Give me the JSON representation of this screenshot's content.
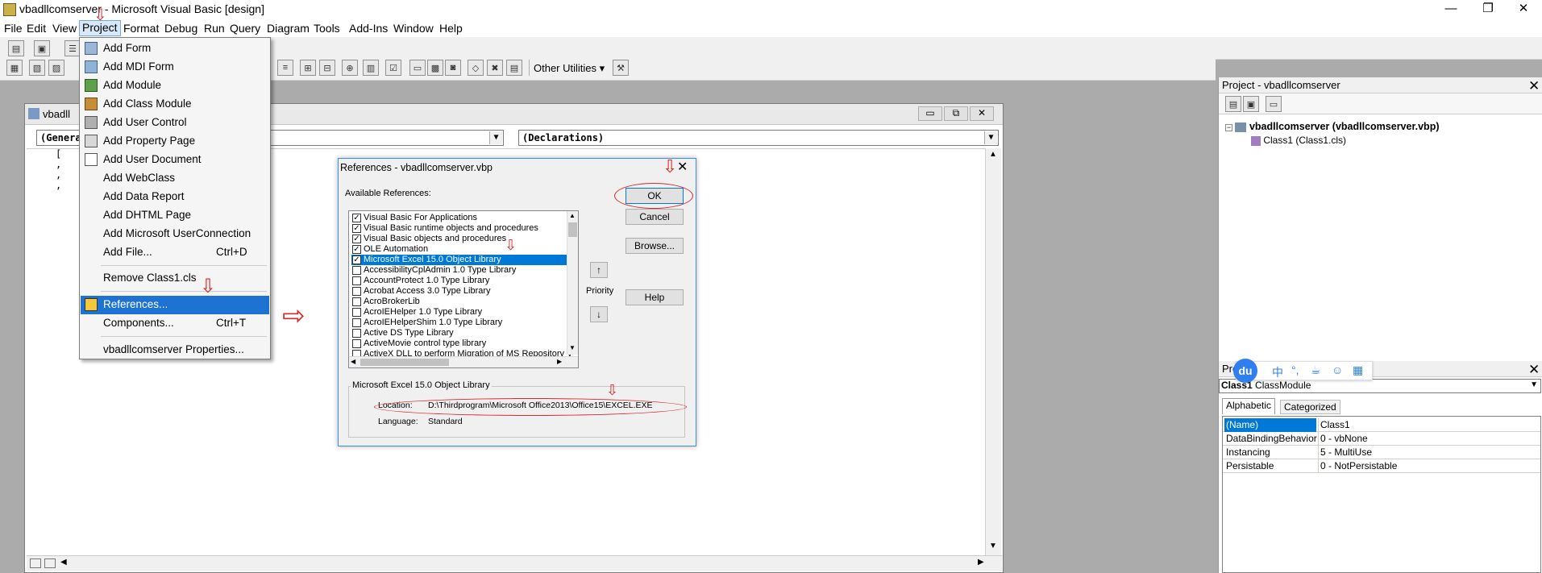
{
  "window": {
    "title": "vbadllcomserver - Microsoft Visual Basic [design]",
    "minimize": "—",
    "maximize": "❐",
    "close": "✕"
  },
  "menubar": [
    "File",
    "Edit",
    "View",
    "Project",
    "Format",
    "Debug",
    "Run",
    "Query",
    "Diagram",
    "Tools",
    "Add-Ins",
    "Window",
    "Help"
  ],
  "toolbar": {
    "other_utilities": "Other Utilities"
  },
  "code_window": {
    "title": "vbadll",
    "object_combo": "(Genera",
    "procedure_combo": "(Declarations)",
    "code_lines": [
      "[",
      ",",
      ",",
      ","
    ]
  },
  "project_menu": {
    "items": [
      {
        "label": "Add Form",
        "shortcut": ""
      },
      {
        "label": "Add MDI Form",
        "shortcut": ""
      },
      {
        "label": "Add Module",
        "shortcut": ""
      },
      {
        "label": "Add Class Module",
        "shortcut": ""
      },
      {
        "label": "Add User Control",
        "shortcut": ""
      },
      {
        "label": "Add Property Page",
        "shortcut": ""
      },
      {
        "label": "Add User Document",
        "shortcut": ""
      },
      {
        "label": "Add WebClass",
        "shortcut": ""
      },
      {
        "label": "Add Data Report",
        "shortcut": ""
      },
      {
        "label": "Add DHTML Page",
        "shortcut": ""
      },
      {
        "label": "Add Microsoft UserConnection",
        "shortcut": ""
      },
      {
        "label": "Add File...",
        "shortcut": "Ctrl+D"
      },
      {
        "label": "Remove Class1.cls",
        "shortcut": ""
      },
      {
        "label": "References...",
        "shortcut": ""
      },
      {
        "label": "Components...",
        "shortcut": "Ctrl+T"
      },
      {
        "label": "vbadllcomserver Properties...",
        "shortcut": ""
      }
    ]
  },
  "references_dialog": {
    "title": "References - vbadllcomserver.vbp",
    "available_label": "Available References:",
    "ok": "OK",
    "cancel": "Cancel",
    "browse": "Browse...",
    "help": "Help",
    "priority": "Priority",
    "priority_up": "↑",
    "priority_down": "↓",
    "references": [
      {
        "label": "Visual Basic For Applications",
        "checked": true
      },
      {
        "label": "Visual Basic runtime objects and procedures",
        "checked": true
      },
      {
        "label": "Visual Basic objects and procedures",
        "checked": true
      },
      {
        "label": "OLE Automation",
        "checked": true
      },
      {
        "label": "Microsoft Excel 15.0 Object Library",
        "checked": true,
        "selected": true
      },
      {
        "label": "AccessibilityCplAdmin 1.0 Type Library",
        "checked": false
      },
      {
        "label": "AccountProtect 1.0 Type Library",
        "checked": false
      },
      {
        "label": "Acrobat Access 3.0 Type Library",
        "checked": false
      },
      {
        "label": "AcroBrokerLib",
        "checked": false
      },
      {
        "label": "AcroIEHelper 1.0 Type Library",
        "checked": false
      },
      {
        "label": "AcroIEHelperShim 1.0 Type Library",
        "checked": false
      },
      {
        "label": "Active DS Type Library",
        "checked": false
      },
      {
        "label": "ActiveMovie control type library",
        "checked": false
      },
      {
        "label": "ActiveX DLL to perform Migration of MS Repository V",
        "checked": false
      }
    ],
    "details": {
      "group_title": "Microsoft Excel 15.0 Object Library",
      "location_label": "Location:",
      "location_value": "D:\\Thirdprogram\\Microsoft Office2013\\Office15\\EXCEL.EXE",
      "language_label": "Language:",
      "language_value": "Standard"
    }
  },
  "project_explorer": {
    "title": "Project - vbadllcomserver",
    "root": "vbadllcomserver (vbadllcomserver.vbp)",
    "child": "Class1 (Class1.cls)"
  },
  "properties": {
    "title": "Pro",
    "object": "Class1",
    "object_type": "ClassModule",
    "tabs": [
      "Alphabetic",
      "Categorized"
    ],
    "rows": [
      {
        "name": "(Name)",
        "value": "Class1"
      },
      {
        "name": "DataBindingBehavior",
        "value": "0 - vbNone"
      },
      {
        "name": "Instancing",
        "value": "5 - MultiUse"
      },
      {
        "name": "Persistable",
        "value": "0 - NotPersistable"
      }
    ]
  },
  "ime": {
    "logo": "du",
    "lang": "中"
  }
}
